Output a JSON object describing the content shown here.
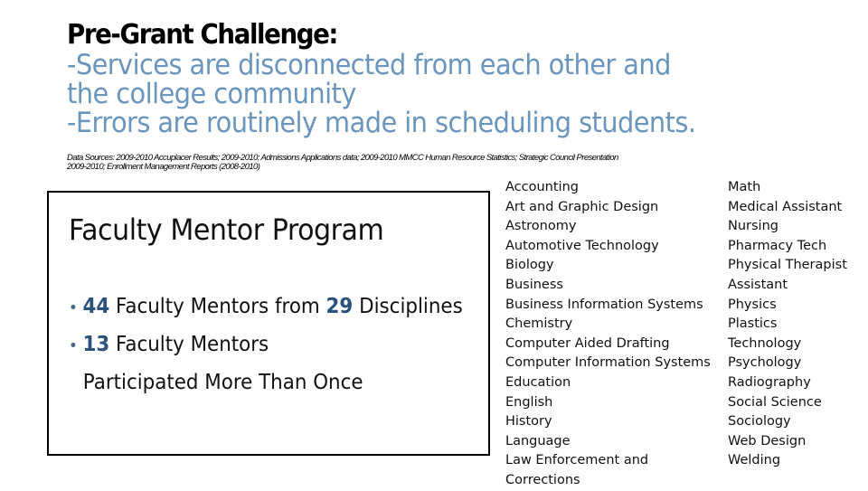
{
  "slide": {
    "title": "Pre-Grant Challenge:",
    "challenges": [
      "-Services are disconnected from each other and",
      "the college community",
      "-Errors are routinely made in scheduling students."
    ],
    "data_sources": [
      "Data Sources: 2009-2010 Accuplacer Results; 2009-2010; Admissions Applications data; 2009-2010 MMCC Human Resource Statistics; Strategic Council Presentation",
      "2009-2010; Enrollment Management Reports (2008-2010)"
    ],
    "colors": {
      "challenge_text": "#6A95BD",
      "highlight_number": "#2A527C"
    }
  },
  "mentor_program": {
    "title": "Faculty Mentor Program",
    "bullets": [
      {
        "num1": "44",
        "text1": " Faculty Mentors from ",
        "num2": "29",
        "text2": " Disciplines"
      },
      {
        "num1": "13",
        "text1": " Faculty Mentors",
        "continuation": "Participated More Than Once"
      }
    ]
  },
  "disciplines": {
    "left": [
      "Accounting",
      "Art and Graphic Design",
      "Astronomy",
      "Automotive Technology",
      "Biology",
      "Business",
      "Business Information Systems",
      "Chemistry",
      "Computer Aided Drafting",
      "Computer Information Systems",
      "Education",
      "English",
      "History",
      "Language",
      "Law Enforcement and",
      "Corrections"
    ],
    "right": [
      "Math",
      "Medical Assistant",
      "Nursing",
      "Pharmacy Tech",
      "Physical Therapist",
      "Assistant",
      "Physics",
      "Plastics",
      "Technology",
      "Psychology",
      "Radiography",
      "Social Science",
      "Sociology",
      "Web Design",
      "Welding"
    ]
  }
}
